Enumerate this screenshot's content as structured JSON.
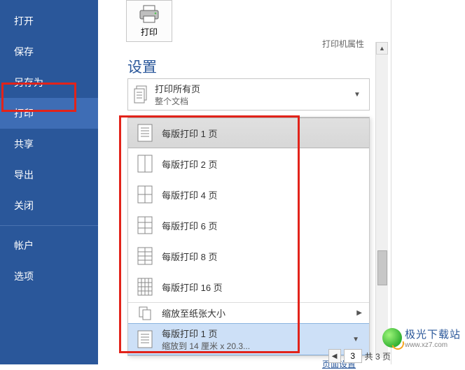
{
  "sidebar": {
    "items": [
      {
        "label": "打开"
      },
      {
        "label": "保存"
      },
      {
        "label": "另存为"
      },
      {
        "label": "打印"
      },
      {
        "label": "共享"
      },
      {
        "label": "导出"
      },
      {
        "label": "关闭"
      }
    ],
    "bottom": [
      {
        "label": "帐户"
      },
      {
        "label": "选项"
      }
    ]
  },
  "main": {
    "print_tile": "打印",
    "trunc": "打印机属性",
    "settings_title": "设置",
    "all_pages": {
      "title": "打印所有页",
      "sub": "整个文档"
    },
    "dropdown": {
      "items": [
        {
          "label": "每版打印 1 页"
        },
        {
          "label": "每版打印 2 页"
        },
        {
          "label": "每版打印 4 页"
        },
        {
          "label": "每版打印 6 页"
        },
        {
          "label": "每版打印 8 页"
        },
        {
          "label": "每版打印 16 页"
        }
      ],
      "scale_label": "缩放至纸张大小",
      "selected": {
        "title": "每版打印 1 页",
        "sub": "缩放到 14 厘米 x 20.3..."
      }
    },
    "footer_link": "页面设置"
  },
  "pager": {
    "current": "3",
    "total_label": "共 3 页"
  },
  "watermark": {
    "name": "极光下载站",
    "url": "www.xz7.com"
  },
  "colors": {
    "sidebar": "#2a579a",
    "annotation": "#e2231a",
    "sel_bg": "#cde0f7"
  }
}
